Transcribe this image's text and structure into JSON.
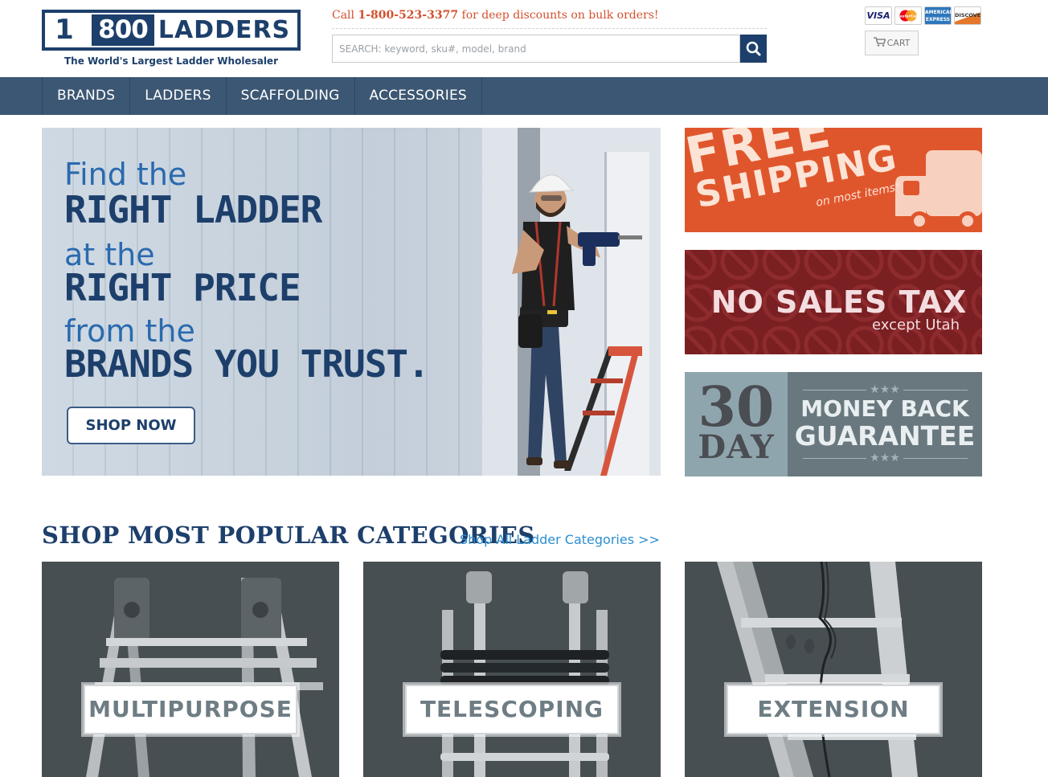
{
  "header": {
    "logo": {
      "digit": "1",
      "number": "800",
      "word": "LADDERS",
      "tagline": "The World's Largest Ladder Wholesaler"
    },
    "callout": {
      "prefix": "Call ",
      "phone": "1-800-523-3377",
      "suffix": " for deep discounts on bulk orders!"
    },
    "search": {
      "placeholder": "SEARCH: keyword, sku#, model, brand",
      "icon": "search-icon"
    },
    "payment_cards": [
      {
        "name": "VISA",
        "color": "#1a1f71"
      },
      {
        "name": "MasterCard",
        "color": "#eb001b"
      },
      {
        "name": "AMERICAN EXPRESS",
        "color": "#2e77bc"
      },
      {
        "name": "DISCOVER",
        "color": "#e5772b"
      }
    ],
    "cart": {
      "label": "CART",
      "icon": "cart-icon"
    }
  },
  "nav": {
    "items": [
      {
        "label": "BRANDS"
      },
      {
        "label": "LADDERS"
      },
      {
        "label": "SCAFFOLDING"
      },
      {
        "label": "ACCESSORIES"
      }
    ]
  },
  "hero": {
    "line1": "Find the",
    "line2": "RIGHT LADDER",
    "line3": "at the",
    "line4": "RIGHT PRICE",
    "line5": "from the",
    "line6": "BRANDS YOU TRUST.",
    "button": "SHOP NOW"
  },
  "promos": {
    "free_shipping": {
      "line1": "FREE",
      "line2": "SHIPPING",
      "note": "on most items*",
      "color": "#e0562c"
    },
    "no_sales_tax": {
      "title": "NO SALES TAX",
      "sub": "except Utah",
      "color": "#7a1f22"
    },
    "money_back": {
      "number": "30",
      "unit": "DAY",
      "line1": "MONEY BACK",
      "line2": "GUARANTEE",
      "stars": "★★★",
      "color": "#69787f"
    }
  },
  "categories": {
    "title": "SHOP MOST POPULAR CATEGORIES",
    "link": "Shop All Ladder Categories >>",
    "items": [
      {
        "label": "MULTIPURPOSE"
      },
      {
        "label": "TELESCOPING"
      },
      {
        "label": "EXTENSION"
      }
    ]
  },
  "colors": {
    "brand_navy": "#1d3f6b",
    "nav_bg": "#3c5773",
    "accent_orange": "#d4502f",
    "link_blue": "#2d8fd0"
  }
}
